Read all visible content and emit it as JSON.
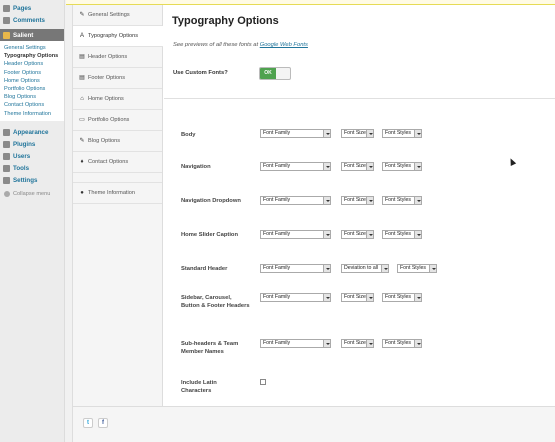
{
  "wp_menu": {
    "top_items": [
      {
        "label": "Pages",
        "icon": "pages-icon"
      },
      {
        "label": "Comments",
        "icon": "comments-icon"
      }
    ],
    "active_item": {
      "label": "Salient",
      "icon": "salient-icon"
    },
    "submenu": [
      "General Settings",
      "Typography Options",
      "Header Options",
      "Footer Options",
      "Home Options",
      "Portfolio Options",
      "Blog Options",
      "Contact Options",
      "Theme Information"
    ],
    "bottom_items": [
      {
        "label": "Appearance",
        "icon": "appearance-icon"
      },
      {
        "label": "Plugins",
        "icon": "plugins-icon"
      },
      {
        "label": "Users",
        "icon": "users-icon"
      },
      {
        "label": "Tools",
        "icon": "tools-icon"
      },
      {
        "label": "Settings",
        "icon": "settings-icon"
      }
    ],
    "collapse": "Collapse menu"
  },
  "tabs": [
    {
      "label": "General Settings",
      "icon": "gear-icon",
      "glyph": "✎"
    },
    {
      "label": "Typography Options",
      "icon": "typography-icon",
      "glyph": "A"
    },
    {
      "label": "Header Options",
      "icon": "header-icon",
      "glyph": "▤"
    },
    {
      "label": "Footer Options",
      "icon": "footer-icon",
      "glyph": "▤"
    },
    {
      "label": "Home Options",
      "icon": "home-icon",
      "glyph": "⌂"
    },
    {
      "label": "Portfolio Options",
      "icon": "folder-icon",
      "glyph": "▭"
    },
    {
      "label": "Blog Options",
      "icon": "pencil-icon",
      "glyph": "✎"
    },
    {
      "label": "Contact Options",
      "icon": "map-marker-icon",
      "glyph": "♦"
    },
    {
      "label": "Theme Information",
      "icon": "info-icon",
      "glyph": "●"
    }
  ],
  "content": {
    "title": "Typography Options",
    "subtitle_prefix": "See previews of all these fonts at",
    "subtitle_link": "Google Web Fonts",
    "custom_fonts_label": "Use Custom Fonts?",
    "toggle_on_label": "OK",
    "font_rows": [
      {
        "label": "Body",
        "family": "Font Family",
        "size": "Font Size",
        "style": "Font Styles"
      },
      {
        "label": "Navigation",
        "family": "Font Family",
        "size": "Font Size",
        "style": "Font Styles"
      },
      {
        "label": "Navigation Dropdown",
        "family": "Font Family",
        "size": "Font Size",
        "style": "Font Styles"
      },
      {
        "label": "Home Slider Caption",
        "family": "Font Family",
        "size": "Font Size",
        "style": "Font Styles"
      },
      {
        "label": "Standard Header",
        "family": "Font Family",
        "size": "Deviation to all",
        "style": "Font Styles"
      },
      {
        "label": "Sidebar, Carousel, Button & Footer Headers",
        "family": "Font Family",
        "size": "Font Size",
        "style": "Font Styles"
      },
      {
        "label": "Sub-headers & Team Member Names",
        "family": "Font Family",
        "size": "Font Size",
        "style": "Font Styles"
      }
    ],
    "latin_label": "Include Latin Characters"
  },
  "footer": {
    "social": [
      {
        "glyph": "t",
        "icon": "twitter-icon"
      },
      {
        "glyph": "f",
        "icon": "facebook-icon"
      }
    ]
  }
}
